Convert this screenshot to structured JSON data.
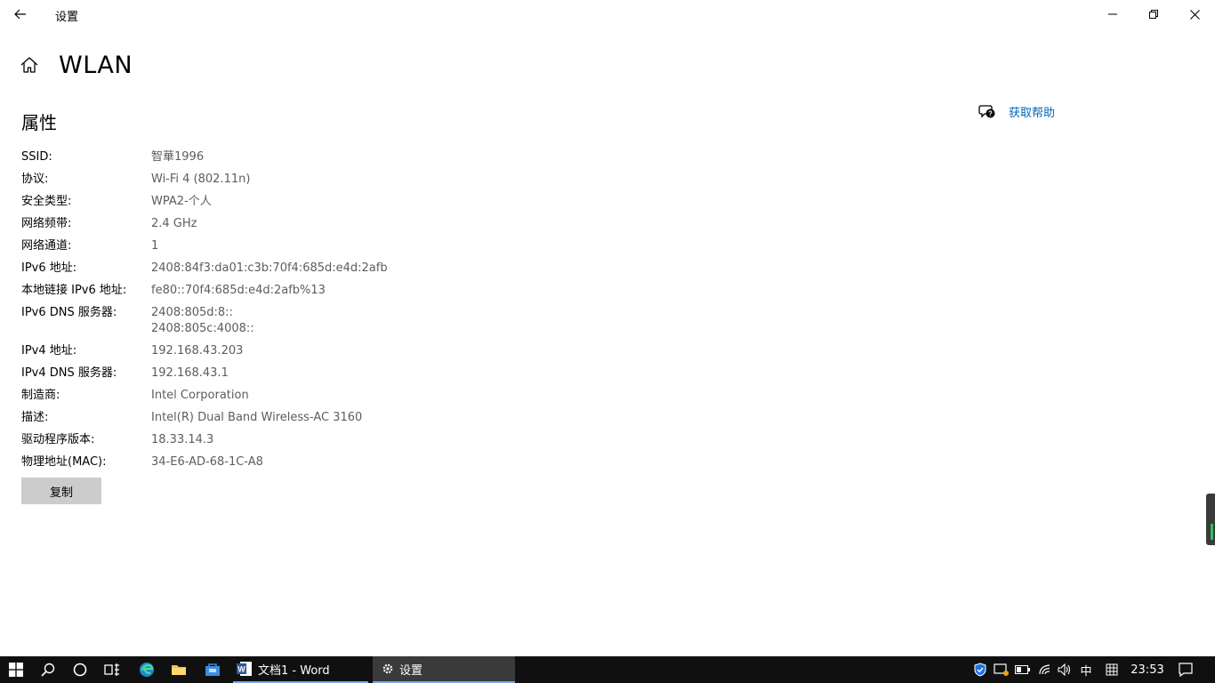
{
  "window": {
    "title": "设置"
  },
  "page": {
    "title": "WLAN",
    "section_title": "属性",
    "help_label": "获取帮助"
  },
  "properties": [
    {
      "label": "SSID:",
      "value": "智華1996"
    },
    {
      "label": "协议:",
      "value": "Wi-Fi 4 (802.11n)"
    },
    {
      "label": "安全类型:",
      "value": "WPA2-个人"
    },
    {
      "label": "网络频带:",
      "value": "2.4 GHz"
    },
    {
      "label": "网络通道:",
      "value": "1"
    },
    {
      "label": "IPv6 地址:",
      "value": "2408:84f3:da01:c3b:70f4:685d:e4d:2afb"
    },
    {
      "label": "本地链接 IPv6 地址:",
      "value": "fe80::70f4:685d:e4d:2afb%13"
    },
    {
      "label": "IPv6 DNS 服务器:",
      "value": "2408:805d:8::",
      "value2": "2408:805c:4008::"
    },
    {
      "label": "IPv4 地址:",
      "value": "192.168.43.203"
    },
    {
      "label": "IPv4 DNS 服务器:",
      "value": "192.168.43.1"
    },
    {
      "label": "制造商:",
      "value": "Intel Corporation"
    },
    {
      "label": "描述:",
      "value": "Intel(R) Dual Band Wireless-AC 3160"
    },
    {
      "label": "驱动程序版本:",
      "value": "18.33.14.3"
    },
    {
      "label": "物理地址(MAC):",
      "value": "34-E6-AD-68-1C-A8"
    }
  ],
  "copy_button": "复制",
  "taskbar": {
    "word_label": "文档1 - Word",
    "settings_label": "设置",
    "ime_label": "中",
    "clock": "23:53"
  },
  "colors": {
    "accent_link": "#0067b8",
    "taskbar_bg": "#101010",
    "value_text": "#5d5d5d"
  }
}
